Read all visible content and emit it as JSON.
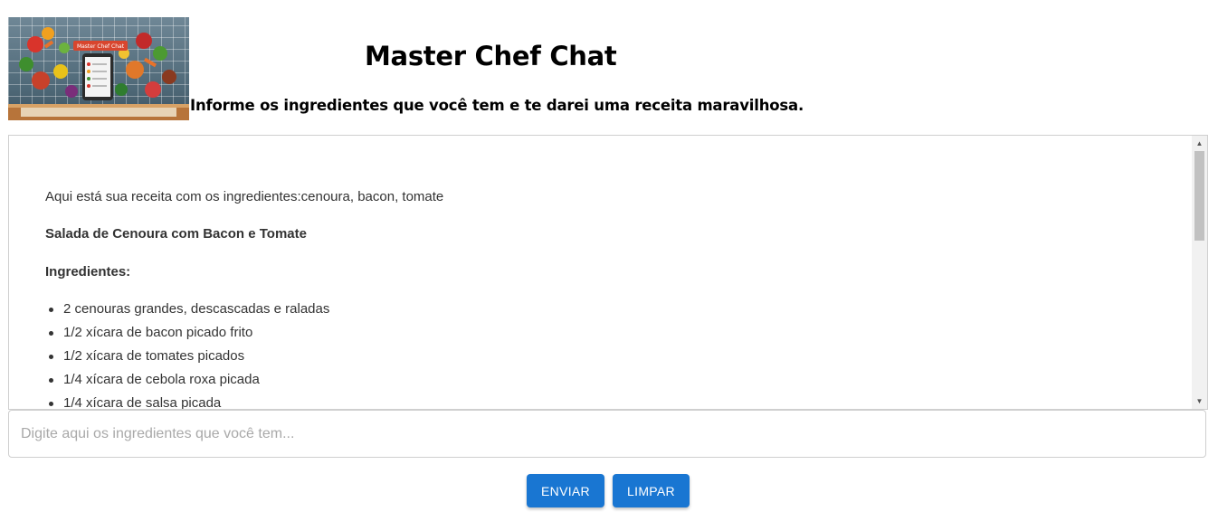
{
  "header": {
    "logo_text": "Master Chef Chat",
    "title": "Master Chef Chat",
    "subtitle": "Informe os ingredientes que você tem e te darei uma receita maravilhosa."
  },
  "chat": {
    "intro": "Aqui está sua receita com os ingredientes:cenoura, bacon, tomate",
    "recipe_title": "Salada de Cenoura com Bacon e Tomate",
    "ingredients_heading": "Ingredientes:",
    "ingredients": [
      "2 cenouras grandes, descascadas e raladas",
      "1/2 xícara de bacon picado frito",
      "1/2 xícara de tomates picados",
      "1/4 xícara de cebola roxa picada",
      "1/4 xícara de salsa picada"
    ]
  },
  "input": {
    "placeholder": "Digite aqui os ingredientes que você tem...",
    "value": ""
  },
  "buttons": {
    "send_label": "ENVIAR",
    "clear_label": "LIMPAR"
  },
  "colors": {
    "button_bg": "#1976d2",
    "button_text": "#ffffff"
  }
}
